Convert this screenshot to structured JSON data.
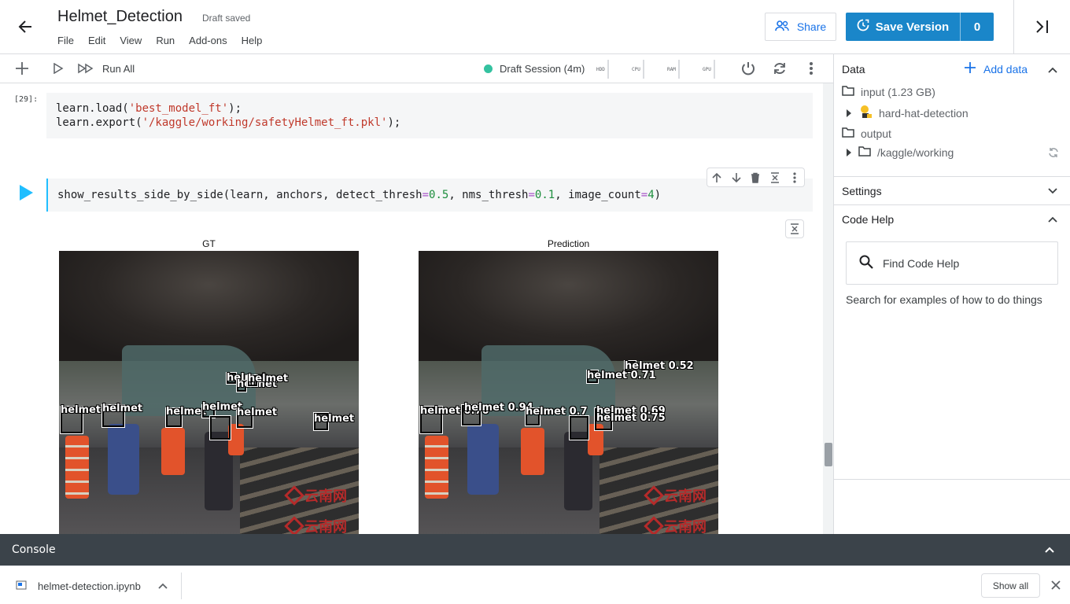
{
  "header": {
    "title": "Helmet_Detection",
    "status": "Draft saved",
    "menu": [
      "File",
      "Edit",
      "View",
      "Run",
      "Add-ons",
      "Help"
    ],
    "share_label": "Share",
    "save_version_label": "Save Version",
    "version_count": "0"
  },
  "toolbar": {
    "run_all_label": "Run All",
    "session_label": "Draft Session (4m)",
    "meters": [
      "HDD",
      "CPU",
      "RAM",
      "GPU"
    ],
    "session_color": "#34c2a0"
  },
  "cells": [
    {
      "exec_count": "[29]:",
      "lines": [
        {
          "prefix": "learn.load(",
          "str": "'best_model_ft'",
          "suffix": ");"
        },
        {
          "prefix": "learn.export(",
          "str": "'/kaggle/working/safetyHelmet_ft.pkl'",
          "suffix": ");"
        }
      ]
    },
    {
      "code": {
        "p1": "show_results_side_by_side(learn, anchors, detect_thresh",
        "eq1": "=",
        "v1": "0.5",
        "p2": ", nms_thresh",
        "eq2": "=",
        "v2": "0.1",
        "p3": ", image_count",
        "eq3": "=",
        "v3": "4",
        "p4": ")"
      }
    }
  ],
  "output": {
    "gt_title": "GT",
    "pred_title": "Prediction",
    "gt_labels": [
      "helmet",
      "helmet",
      "helmet",
      "helmet",
      "helmet",
      "helmet",
      "helmet",
      "helmet",
      "helmet"
    ],
    "pred_labels": [
      "helmet 0.52",
      "helmet 0.71",
      "helmet 0.70",
      "helmet 0.94",
      "helmet 0.7",
      "helmet 0.69",
      "helmet 0.75"
    ]
  },
  "right_panel": {
    "data_heading": "Data",
    "add_data_label": "Add data",
    "input_label": "input (1.23 GB)",
    "dataset_label": "hard-hat-detection",
    "output_label": "output",
    "working_label": "/kaggle/working",
    "settings_heading": "Settings",
    "code_help_heading": "Code Help",
    "search_placeholder": "Find Code Help",
    "search_hint": "Search for examples of how to do things"
  },
  "console": {
    "label": "Console"
  },
  "downloads": {
    "filename": "helmet-detection.ipynb",
    "show_all_label": "Show all"
  },
  "colors": {
    "accent": "#1a86c9",
    "link": "#1a73e8",
    "run_button": "#20beff",
    "console_bg": "#3b434a"
  }
}
